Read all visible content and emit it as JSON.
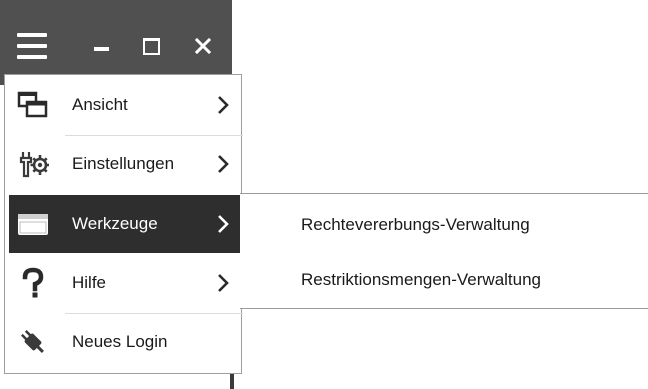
{
  "window": {
    "menu_icon": "hamburger-menu-icon",
    "minimize_icon": "minimize-icon",
    "maximize_icon": "maximize-icon",
    "close_icon": "close-icon"
  },
  "menu": {
    "items": [
      {
        "label": "Ansicht",
        "icon": "windows-view-icon",
        "has_submenu": true
      },
      {
        "label": "Einstellungen",
        "icon": "tools-gear-icon",
        "has_submenu": true
      },
      {
        "label": "Werkzeuge",
        "icon": "toolbox-icon",
        "has_submenu": true,
        "active": true
      },
      {
        "label": "Hilfe",
        "icon": "question-mark-icon",
        "has_submenu": true
      },
      {
        "label": "Neues Login",
        "icon": "plug-icon",
        "has_submenu": false
      }
    ]
  },
  "submenu": {
    "items": [
      {
        "label": "Rechtevererbungs-Verwaltung"
      },
      {
        "label": "Restriktionsmengen-Verwaltung"
      }
    ]
  },
  "colors": {
    "titlebar": "#505050",
    "active_item": "#2e2e2e",
    "text": "#1a1a1a"
  }
}
